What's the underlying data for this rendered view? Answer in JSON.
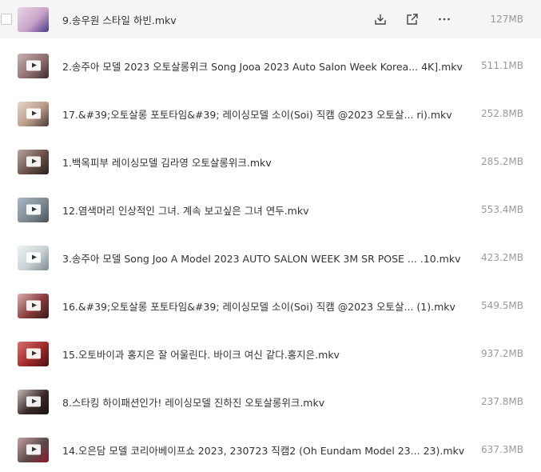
{
  "files": [
    {
      "name": "9.송우원 스타일 하빈.mkv",
      "size": "127MB",
      "thumb_color": "#c9a4c8",
      "hover": true
    },
    {
      "name": "2.송주아 모델 2023 오토살롱위크 Song Jooa 2023 Auto Salon Week Korea... 4K].mkv",
      "size": "511.1MB",
      "thumb_color": "#8a6a6a"
    },
    {
      "name": "17.&#39;오토살롱 포토타임&#39; 레이싱모델 소이(Soi) 직캠 @2023 오토살...   ri).mkv",
      "size": "252.8MB",
      "thumb_color": "#b89a88"
    },
    {
      "name": "1.백옥피부 레이싱모델 김라영 오토살롱위크.mkv",
      "size": "285.2MB",
      "thumb_color": "#6a5048"
    },
    {
      "name": "12.염색머리 인상적인 그녀. 계속 보고싶은 그녀 연두.mkv",
      "size": "553.4MB",
      "thumb_color": "#7d8a92"
    },
    {
      "name": "3.송주아 모델 Song Joo A Model 2023 AUTO SALON WEEK 3M SR POSE ...  .10.mkv",
      "size": "423.2MB",
      "thumb_color": "#c9d0d3"
    },
    {
      "name": "16.&#39;오토살롱 포토타임&#39; 레이싱모델 소이(Soi) 직캠 @2023 오토살...  (1).mkv",
      "size": "549.5MB",
      "thumb_color": "#8a3a3a"
    },
    {
      "name": "15.오토바이과 홍지은 잘 어울린다. 바이크 여신 같다.홍지은.mkv",
      "size": "937.2MB",
      "thumb_color": "#a02a2a"
    },
    {
      "name": "8.스타킹 하이패션인가! 레이싱모델 진하진 오토살롱위크.mkv",
      "size": "237.8MB",
      "thumb_color": "#3a2a2a"
    },
    {
      "name": "14.오은담 모델 코리아베이프쇼 2023, 230723 직캠2 (Oh Eundam Model 23... 23).mkv",
      "size": "637.3MB",
      "thumb_color": "#5a4a4a"
    }
  ],
  "icons": {
    "download": "download-icon",
    "share": "share-icon",
    "more": "more-icon"
  }
}
